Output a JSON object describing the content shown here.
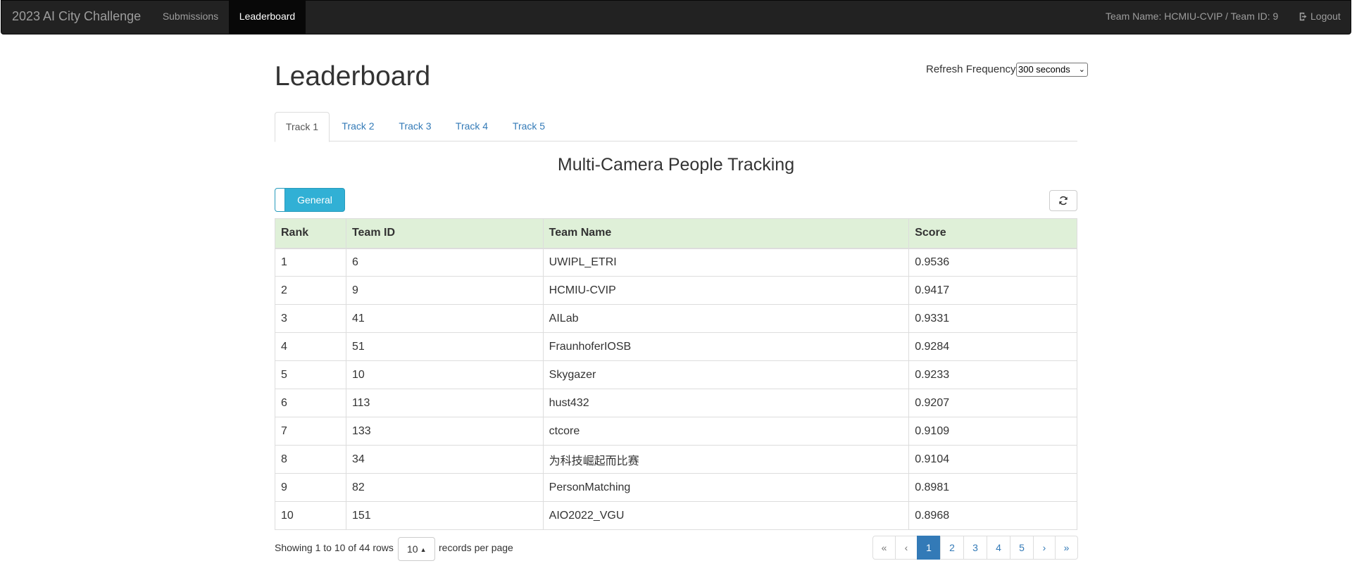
{
  "navbar": {
    "brand": "2023 AI City Challenge",
    "links": [
      "Submissions",
      "Leaderboard"
    ],
    "team_info": "Team Name: HCMIU-CVIP / Team ID: 9",
    "logout": "Logout"
  },
  "page": {
    "title": "Leaderboard",
    "refresh_label": "Refresh Frequency",
    "refresh_value": "300 seconds"
  },
  "tabs": [
    "Track 1",
    "Track 2",
    "Track 3",
    "Track 4",
    "Track 5"
  ],
  "section_title": "Multi-Camera People Tracking",
  "toggle_label": "General",
  "table": {
    "headers": [
      "Rank",
      "Team ID",
      "Team Name",
      "Score"
    ],
    "rows": [
      [
        "1",
        "6",
        "UWIPL_ETRI",
        "0.9536"
      ],
      [
        "2",
        "9",
        "HCMIU-CVIP",
        "0.9417"
      ],
      [
        "3",
        "41",
        "AILab",
        "0.9331"
      ],
      [
        "4",
        "51",
        "FraunhoferIOSB",
        "0.9284"
      ],
      [
        "5",
        "10",
        "Skygazer",
        "0.9233"
      ],
      [
        "6",
        "113",
        "hust432",
        "0.9207"
      ],
      [
        "7",
        "133",
        "ctcore",
        "0.9109"
      ],
      [
        "8",
        "34",
        "为科技崛起而比赛",
        "0.9104"
      ],
      [
        "9",
        "82",
        "PersonMatching",
        "0.8981"
      ],
      [
        "10",
        "151",
        "AIO2022_VGU",
        "0.8968"
      ]
    ]
  },
  "footer": {
    "showing": "Showing 1 to 10 of 44 rows",
    "page_size": "10",
    "per_page": "records per page"
  },
  "pagination": [
    "«",
    "‹",
    "1",
    "2",
    "3",
    "4",
    "5",
    "›",
    "»"
  ],
  "colors": {
    "navbar_bg": "#222222",
    "header_row_bg": "#dff0d8",
    "link": "#337ab7",
    "toggle_bg": "#31b0d5"
  }
}
